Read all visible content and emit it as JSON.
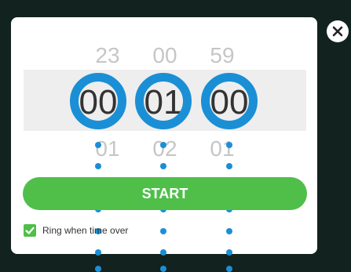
{
  "dialog": {
    "hours": {
      "prev": "23",
      "selected": "00",
      "next": "01"
    },
    "minutes": {
      "prev": "00",
      "selected": "01",
      "next": "02"
    },
    "seconds": {
      "prev": "59",
      "selected": "00",
      "next": "01"
    },
    "start_label": "START",
    "ring_label": "Ring when time over",
    "ring_checked": true
  },
  "colors": {
    "accent": "#4fbf4a",
    "overlay_marker": "#1a8fd6",
    "backdrop": "#12221e"
  },
  "icons": {
    "close": "close-icon",
    "check": "check-icon"
  }
}
